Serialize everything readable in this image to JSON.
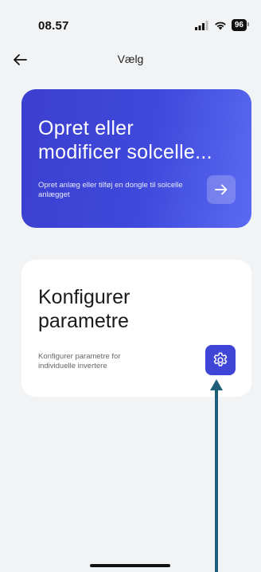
{
  "status_bar": {
    "time": "08.57",
    "battery": "96",
    "icons": [
      "signal-icon",
      "wifi-icon",
      "battery-icon"
    ]
  },
  "nav": {
    "title": "Vælg",
    "back_icon": "arrow-left-icon"
  },
  "cards": {
    "create": {
      "title_line1": "Opret eller",
      "title_line2": "modificer solcelle...",
      "description": "Opret anlæg eller tilføj en dongle til solcelle anlægget",
      "action_icon": "arrow-right-icon"
    },
    "configure": {
      "title": "Konfigurer parametre",
      "description": "Konfigurer parametre for individuelle invertere",
      "action_icon": "gear-icon"
    }
  },
  "colors": {
    "background": "#f2f3f5",
    "accent": "#3f45d6",
    "annotation_arrow": "#1f5f7a"
  }
}
